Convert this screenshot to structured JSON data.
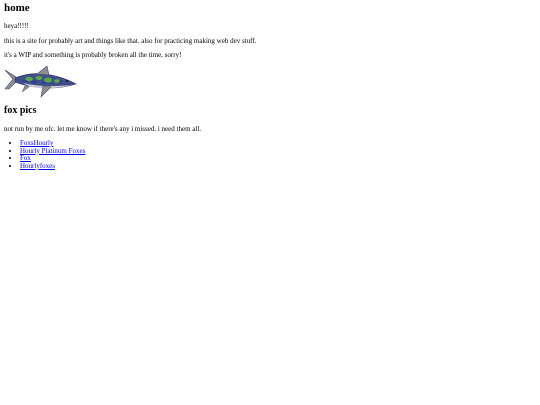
{
  "header": {
    "title": "home"
  },
  "intro": {
    "greeting": "heya!!!!!",
    "description": "this is a site for probably art and things like that. also for practicing making web dev stuff.",
    "disclaimer": "it's a WIP and something is probably broken all the time, sorry!"
  },
  "image": {
    "icon": "shark-image",
    "colors": {
      "body": "#3f4f8a",
      "pattern_green": "#5aa84a",
      "pattern_blue": "#2f3f9a",
      "fin_gray": "#8d9099",
      "belly": "#c9ccd4"
    }
  },
  "fox_section": {
    "heading": "fox pics",
    "note": "not run by me ofc. let me know if there's any i missed. i need them all.",
    "links": [
      {
        "label": "FoxsHourly"
      },
      {
        "label": "Hourly Platinum Foxes"
      },
      {
        "label": "Fox"
      },
      {
        "label": "Hourlyfoxes"
      }
    ]
  },
  "colors": {
    "background": "#ffffff",
    "text": "#000000",
    "link": "#0000ee"
  }
}
